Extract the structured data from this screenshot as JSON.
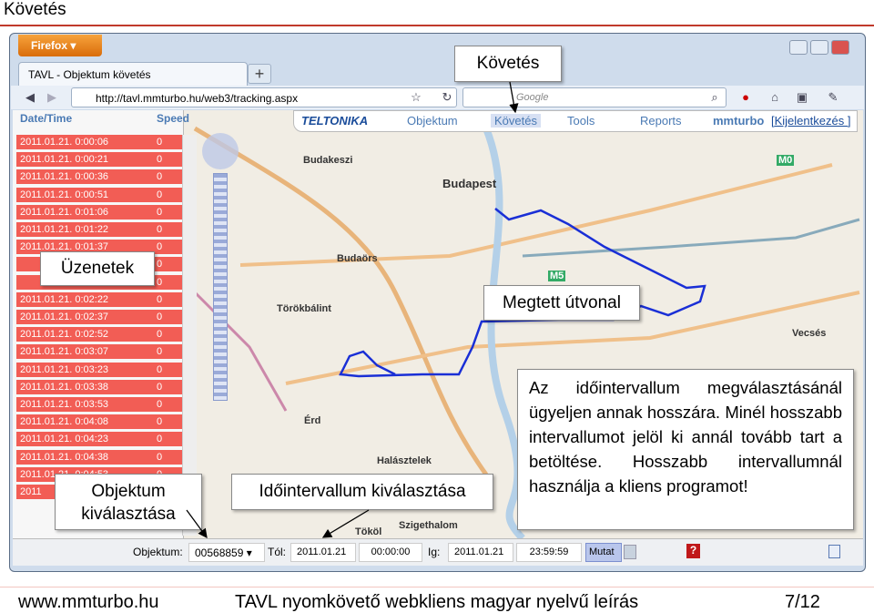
{
  "slide": {
    "title": "Követés",
    "footer_left": "www.mmturbo.hu",
    "footer_center": "TAVL nyomkövető webkliens magyar nyelvű leírás",
    "footer_right": "7/12"
  },
  "browser": {
    "firefox_label": "Firefox ▾",
    "tab_title": "TAVL - Objektum követés",
    "url": "http://tavl.mmturbo.hu/web3/tracking.aspx",
    "search_placeholder": "Google"
  },
  "app": {
    "logo": "TELTONIKA",
    "menu": [
      "Objektum",
      "Követés",
      "Tools",
      "Reports"
    ],
    "user": "mmturbo",
    "logout": "[Kijelentkezés ]",
    "columns": [
      "Date/Time",
      "Speed"
    ],
    "rows": [
      {
        "time": "2011.01.21. 0:00:06",
        "speed": "0"
      },
      {
        "time": "2011.01.21. 0:00:21",
        "speed": "0"
      },
      {
        "time": "2011.01.21. 0:00:36",
        "speed": "0"
      },
      {
        "time": "2011.01.21. 0:00:51",
        "speed": "0"
      },
      {
        "time": "2011.01.21. 0:01:06",
        "speed": "0"
      },
      {
        "time": "2011.01.21. 0:01:22",
        "speed": "0"
      },
      {
        "time": "2011.01.21. 0:01:37",
        "speed": "0"
      },
      {
        "time": "",
        "speed": "0"
      },
      {
        "time": "",
        "speed": "0"
      },
      {
        "time": "2011.01.21. 0:02:22",
        "speed": "0"
      },
      {
        "time": "2011.01.21. 0:02:37",
        "speed": "0"
      },
      {
        "time": "2011.01.21. 0:02:52",
        "speed": "0"
      },
      {
        "time": "2011.01.21. 0:03:07",
        "speed": "0"
      },
      {
        "time": "2011.01.21. 0:03:23",
        "speed": "0"
      },
      {
        "time": "2011.01.21. 0:03:38",
        "speed": "0"
      },
      {
        "time": "2011.01.21. 0:03:53",
        "speed": "0"
      },
      {
        "time": "2011.01.21. 0:04:08",
        "speed": "0"
      },
      {
        "time": "2011.01.21. 0:04:23",
        "speed": "0"
      },
      {
        "time": "2011.01.21. 0:04:38",
        "speed": "0"
      },
      {
        "time": "2011.01.21. 0:04:53",
        "speed": "0"
      },
      {
        "time": "2011",
        "speed": "0"
      }
    ],
    "bottom": {
      "objektum_label": "Objektum:",
      "objektum_value": "00568859",
      "tol_label": "Tól:",
      "tol_date": "2011.01.21",
      "tol_time": "00:00:00",
      "ig_label": "Ig:",
      "ig_date": "2011.01.21",
      "ig_time": "23:59:59",
      "mutat": "Mutat"
    },
    "map_labels": [
      "Budakeszi",
      "Budapest",
      "Budaörs",
      "Törökbálint",
      "Érd",
      "Halásztelek",
      "Szigethalom",
      "Tököl",
      "Vecsés",
      "M5",
      "M0"
    ]
  },
  "callouts": {
    "kovetes": "Követés",
    "uzenetek": "Üzenetek",
    "utvonal": "Megtett útvonal",
    "objektum": "Objektum kiválasztása",
    "idointervallum": "Időintervallum kiválasztása",
    "info": "Az időintervallum megválasztásánál ügyeljen annak hosszára. Minél hosszabb intervallumot jelöl ki annál tovább tart a betöltése. Hosszabb intervallumnál használja a kliens programot!"
  },
  "colors": {
    "row": "#f25d55",
    "route": "#1a2fd6",
    "menu_text": "#4a7ab4"
  }
}
